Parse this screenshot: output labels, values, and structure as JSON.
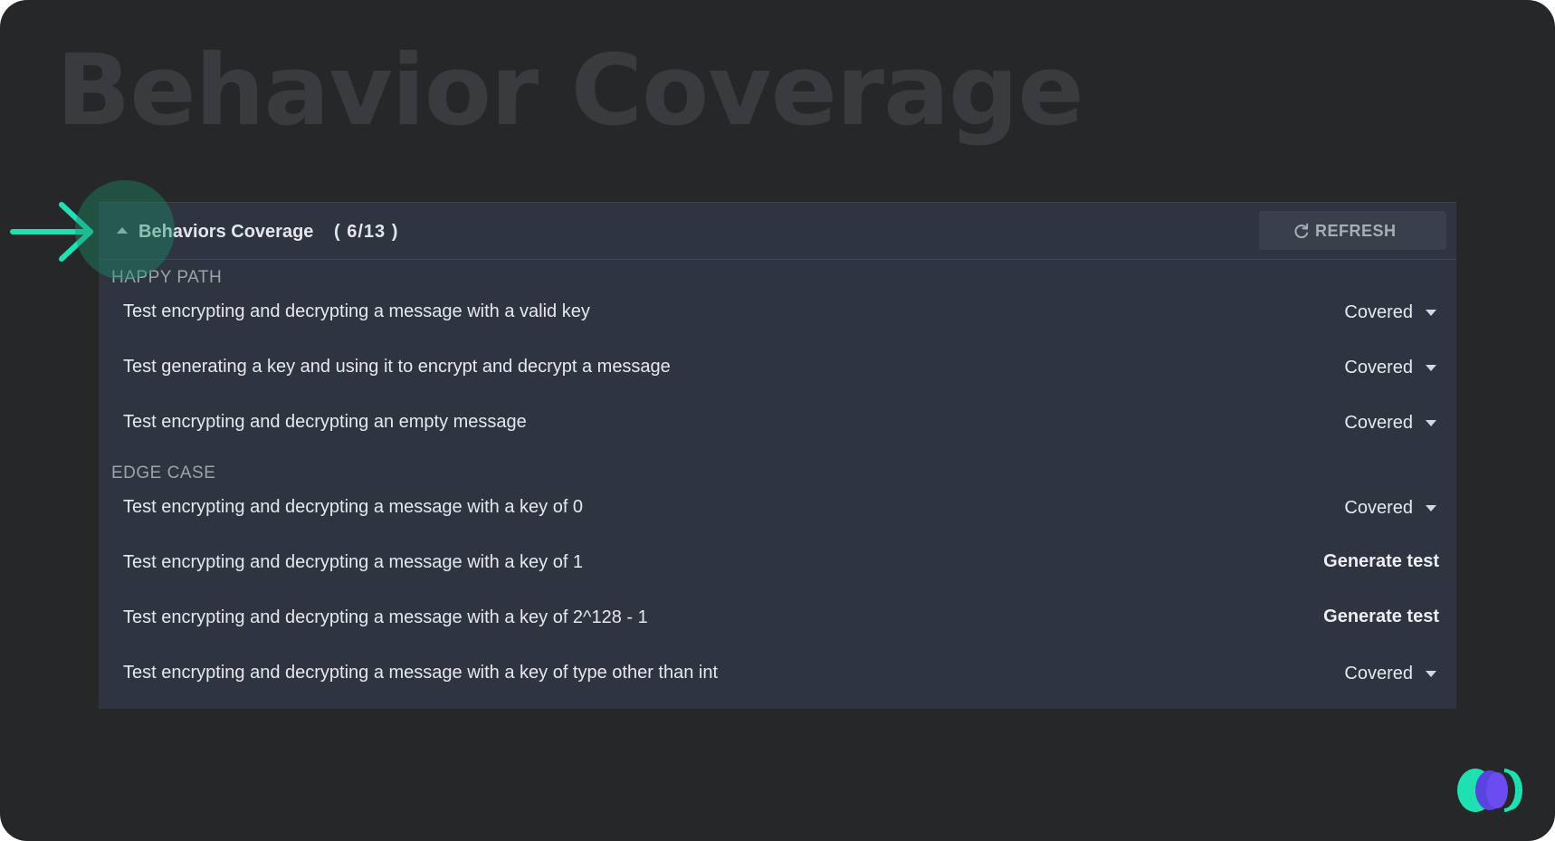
{
  "page": {
    "title": "Behavior Coverage"
  },
  "panel": {
    "title": "Behaviors Coverage",
    "count": "( 6/13 )",
    "refresh_label": "REFRESH"
  },
  "sections": [
    {
      "label": "HAPPY PATH",
      "rows": [
        {
          "text": "Test encrypting and decrypting a message with a valid key",
          "status": "Covered"
        },
        {
          "text": "Test generating a key and using it to encrypt and decrypt a message",
          "status": "Covered"
        },
        {
          "text": "Test encrypting and decrypting an empty message",
          "status": "Covered"
        }
      ]
    },
    {
      "label": "EDGE CASE",
      "rows": [
        {
          "text": "Test encrypting and decrypting a message with a key of 0",
          "status": "Covered"
        },
        {
          "text": "Test encrypting and decrypting a message with a key of 1",
          "action": "Generate test"
        },
        {
          "text": "Test encrypting and decrypting a message with a key of 2^128 - 1",
          "action": "Generate test"
        },
        {
          "text": "Test encrypting and decrypting a message with a key of type other than int",
          "status": "Covered"
        }
      ]
    }
  ],
  "icons": {
    "collapse": "chevron-up-icon",
    "refresh": "refresh-icon",
    "dropdown": "chevron-down-icon",
    "pointer": "arrow-right-icon",
    "brand": "brand-logo"
  },
  "colors": {
    "background": "#262729",
    "panel": "#2f3441",
    "accent": "#1fe0b0",
    "logo_purple": "#6a4cf0"
  }
}
